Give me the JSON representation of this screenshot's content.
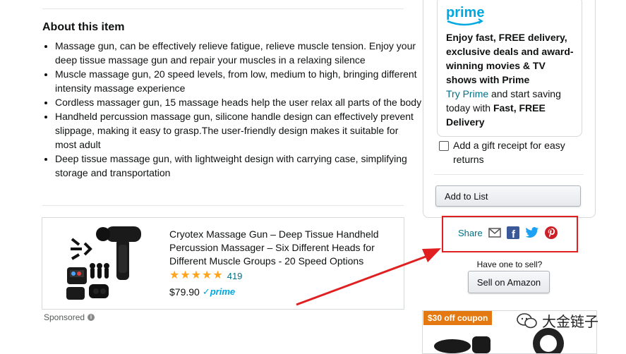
{
  "about": {
    "title": "About this item",
    "bullets": [
      "Massage gun, can be effectively relieve fatigue, relieve muscle tension. Enjoy your deep tissue massage gun and repair your muscles in a relaxing silence",
      "Muscle massage gun, 20 speed levels, from low, medium to high, bringing different intensity massage experience",
      "Cordless massager gun, 15 massage heads help the user relax all parts of the body",
      "Handheld percussion massage gun, silicone handle design can effectively prevent slippage, making it easy to grasp.The user-friendly design makes it suitable for most adult",
      "Deep tissue massage gun, with lightweight design with carrying case, simplifying storage and transportation"
    ]
  },
  "ad": {
    "title": "Cryotex Massage Gun – Deep Tissue Handheld Percussion Massager – Six Different Heads for Different Muscle Groups - 20 Speed Options",
    "rating": 5,
    "review_count": "419",
    "price": "$79.90",
    "prime_badge": "prime",
    "sponsored_label": "Sponsored",
    "info_icon_glyph": "i"
  },
  "buybox": {
    "prime_logo": "prime",
    "prime_headline": "Enjoy fast, FREE delivery, exclusive deals and award-winning movies & TV shows with Prime",
    "try_prime_link": "Try Prime",
    "prime_sub_mid": " and start saving today with ",
    "prime_sub_bold": "Fast, FREE Delivery",
    "gift_label": "Add a gift receipt for easy returns",
    "add_to_list": "Add to List"
  },
  "share": {
    "label": "Share",
    "icons": [
      "email-icon",
      "facebook-icon",
      "twitter-icon",
      "pinterest-icon"
    ],
    "facebook_glyph": "f"
  },
  "sell": {
    "question": "Have one to sell?",
    "button": "Sell on Amazon"
  },
  "coupon": {
    "label": "$30 off coupon"
  },
  "watermark": {
    "text": "大金链子"
  },
  "colors": {
    "link": "#007185",
    "star": "#ffa41c",
    "highlight_box": "#e02020",
    "coupon_bg": "#e47911",
    "prime_blue": "#00a8e1"
  }
}
